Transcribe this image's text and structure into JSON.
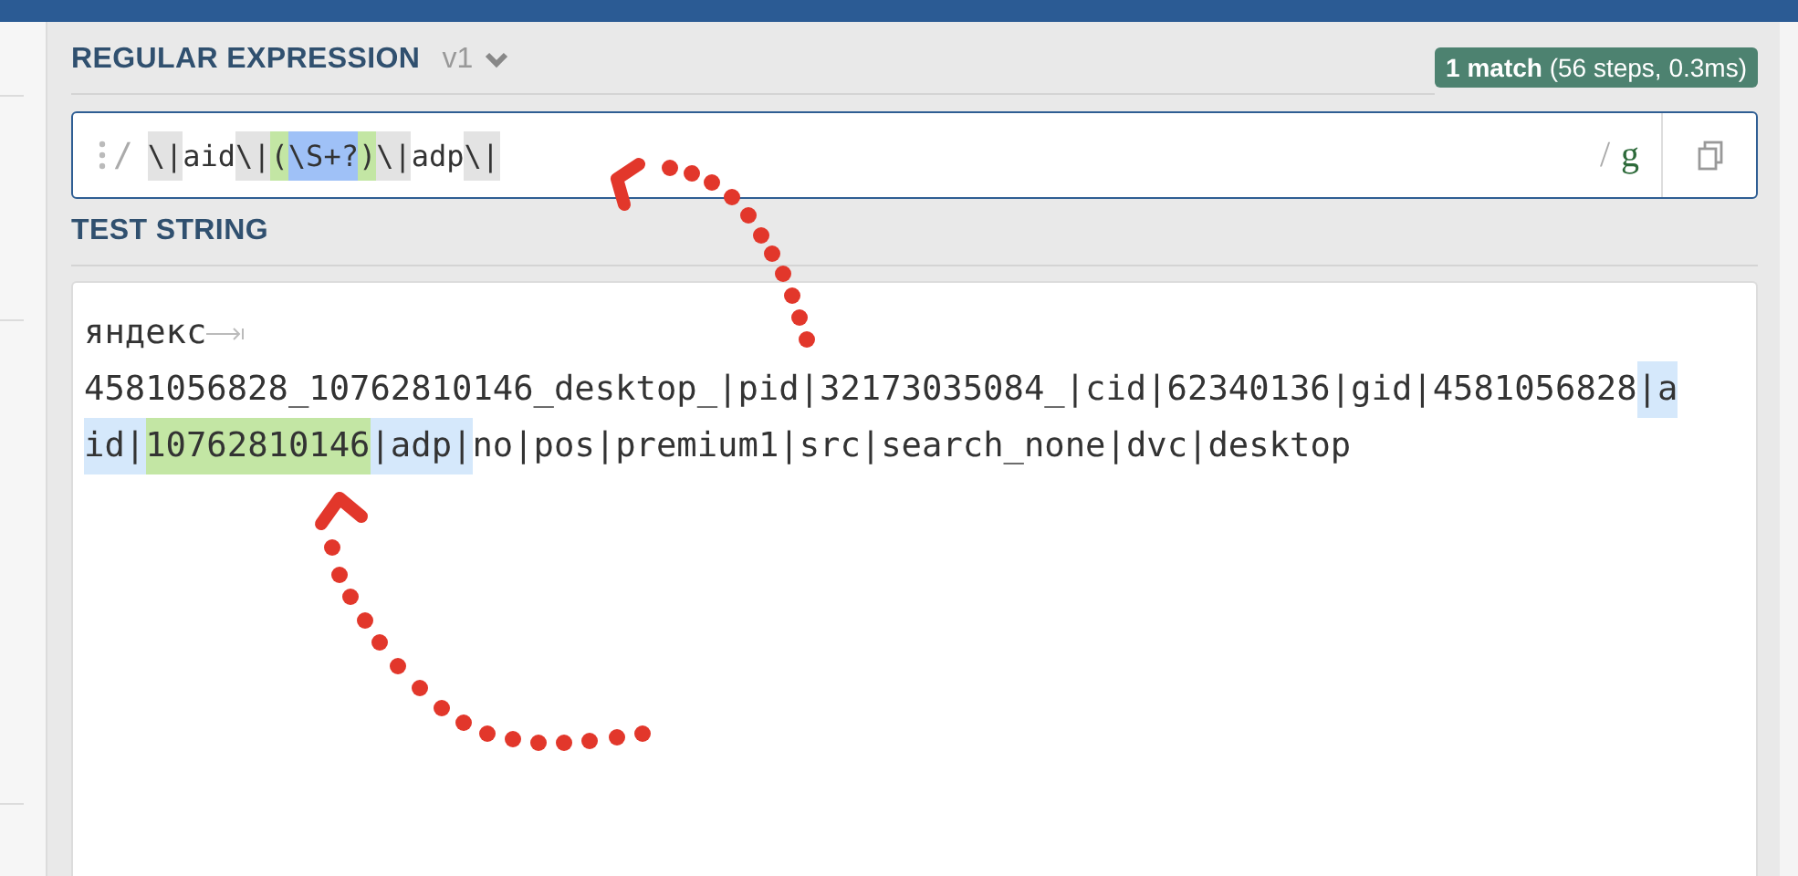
{
  "regex_section": {
    "title": "REGULAR EXPRESSION",
    "version": "v1",
    "match_info": "**1 match** (56 steps, 0.3ms)"
  },
  "regex": {
    "open_delimiter": "/",
    "close_delimiter": "/",
    "flags": "g",
    "tokens": [
      {
        "text": "\\|",
        "kind": "escape"
      },
      {
        "text": "aid",
        "kind": "plain"
      },
      {
        "text": "\\|",
        "kind": "escape"
      },
      {
        "text": "(",
        "kind": "group"
      },
      {
        "text": "\\S+?",
        "kind": "class"
      },
      {
        "text": ")",
        "kind": "group"
      },
      {
        "text": "\\|",
        "kind": "escape"
      },
      {
        "text": "adp",
        "kind": "plain"
      },
      {
        "text": "\\|",
        "kind": "escape"
      }
    ]
  },
  "test_section": {
    "title": "TEST STRING"
  },
  "test_string": {
    "lines": [
      {
        "tab": true,
        "segments": [
          {
            "text": "яндекс",
            "kind": "plain"
          }
        ]
      },
      {
        "tab": false,
        "segments": [
          {
            "text": "4581056828_10762810146_desktop_|pid|32173035084_|cid|62340136|gid|4581056828",
            "kind": "plain"
          },
          {
            "text": "|a",
            "kind": "match"
          }
        ]
      },
      {
        "tab": false,
        "segments": [
          {
            "text": "id|",
            "kind": "match"
          },
          {
            "text": "10762810146",
            "kind": "group"
          },
          {
            "text": "|adp|",
            "kind": "match"
          },
          {
            "text": "no|pos|premium1|src|search_none|dvc|desktop",
            "kind": "plain"
          }
        ]
      }
    ]
  }
}
